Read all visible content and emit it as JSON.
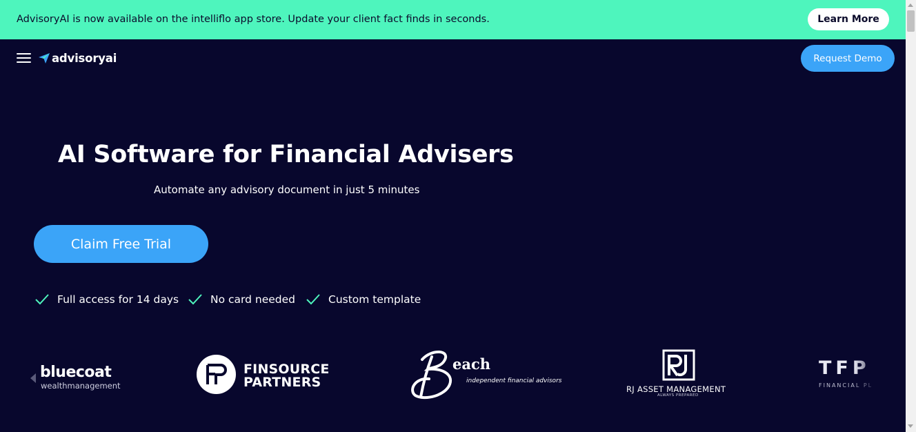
{
  "announcement": {
    "text": "AdvisoryAI is now available on the intelliflo app store. Update your client fact finds in seconds.",
    "cta_label": "Learn More",
    "background": "#4ef5bd"
  },
  "nav": {
    "menu_icon": "hamburger-menu-icon",
    "logo_text": "advisoryai",
    "logo_icon": "paper-plane-icon",
    "request_demo_label": "Request Demo"
  },
  "hero": {
    "title": "AI Software for Financial Advisers",
    "subtitle": "Automate any advisory document in just 5 minutes",
    "cta_label": "Claim Free Trial",
    "perks": [
      {
        "icon": "check-icon",
        "label": "Full access for 14 days"
      },
      {
        "icon": "check-icon",
        "label": "No card needed"
      },
      {
        "icon": "check-icon",
        "label": "Custom template"
      }
    ]
  },
  "client_logos": {
    "bluecoat": {
      "name": "bluecoat",
      "sub": "wealthmanagement"
    },
    "finsource": {
      "line1": "FINSOURCE",
      "line2": "PARTNERS"
    },
    "beach": {
      "name": "each",
      "sub": "independent financial advisors"
    },
    "rj": {
      "name": "RJ ASSET MANAGEMENT",
      "tagline": "ALWAYS PREPARED"
    },
    "tfp": {
      "name": "TFP",
      "sub": "FINANCIAL PL"
    }
  },
  "colors": {
    "page_background": "#08072d",
    "accent_blue": "#3ba4f8",
    "check_green": "#4ef5bd"
  }
}
